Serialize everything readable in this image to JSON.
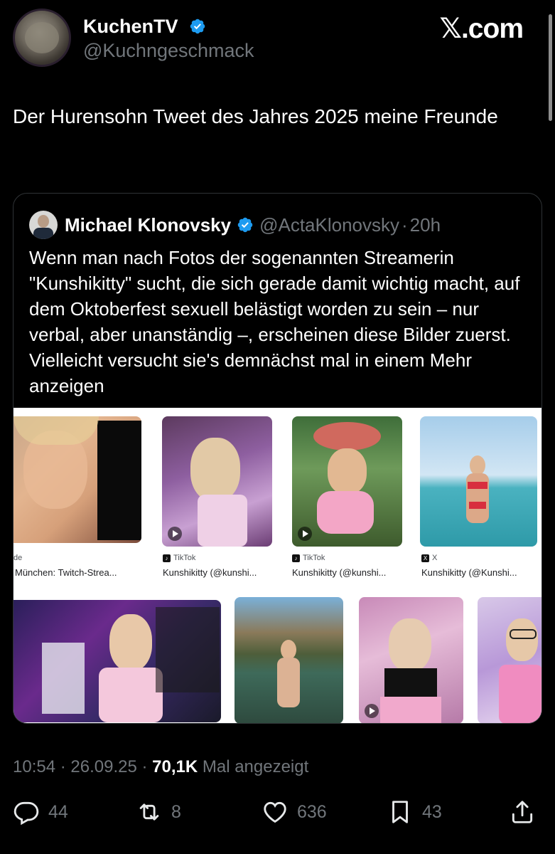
{
  "author": {
    "name": "KuchenTV",
    "handle": "@Kuchngeschmack",
    "verified": true
  },
  "brand": "𝕏.com",
  "tweet": {
    "text": "Der Hurensohn Tweet des Jahres 2025 meine Freunde"
  },
  "quote": {
    "name": "Michael Klonovsky",
    "handle": "@ActaKlonovsky",
    "dot": "·",
    "time": "20h",
    "text": "Wenn man nach Fotos der sogenannten Streamerin \"Kunshikitty\" sucht, die sich gerade damit wichtig macht, auf dem Oktoberfest sexuell belästigt worden zu sein – nur verbal, aber unanständig –, erscheinen diese Bilder zuerst. Vielleicht versucht sie's demnächst mal in einem Mehr anzeigen"
  },
  "results": [
    {
      "source": "de",
      "caption": "München: Twitch-Strea...",
      "icon": "none"
    },
    {
      "source": "TikTok",
      "caption": "Kunshikitty (@kunshi...",
      "icon": "tiktok-icon"
    },
    {
      "source": "TikTok",
      "caption": "Kunshikitty (@kunshi...",
      "icon": "tiktok-icon"
    },
    {
      "source": "X",
      "caption": "Kunshikitty (@Kunshi...",
      "icon": "x-icon"
    }
  ],
  "meta": {
    "time": "10:54 · 26.09.25 · ",
    "views": "70,1K",
    "views_label": " Mal angezeigt"
  },
  "actions": {
    "replies": "44",
    "reposts": "8",
    "likes": "636",
    "bookmarks": "43"
  },
  "colors": {
    "background": "#000000",
    "text": "#e7e9ea",
    "secondary": "#71767b",
    "verified": "#1d9bf0",
    "border": "#2f3336"
  }
}
